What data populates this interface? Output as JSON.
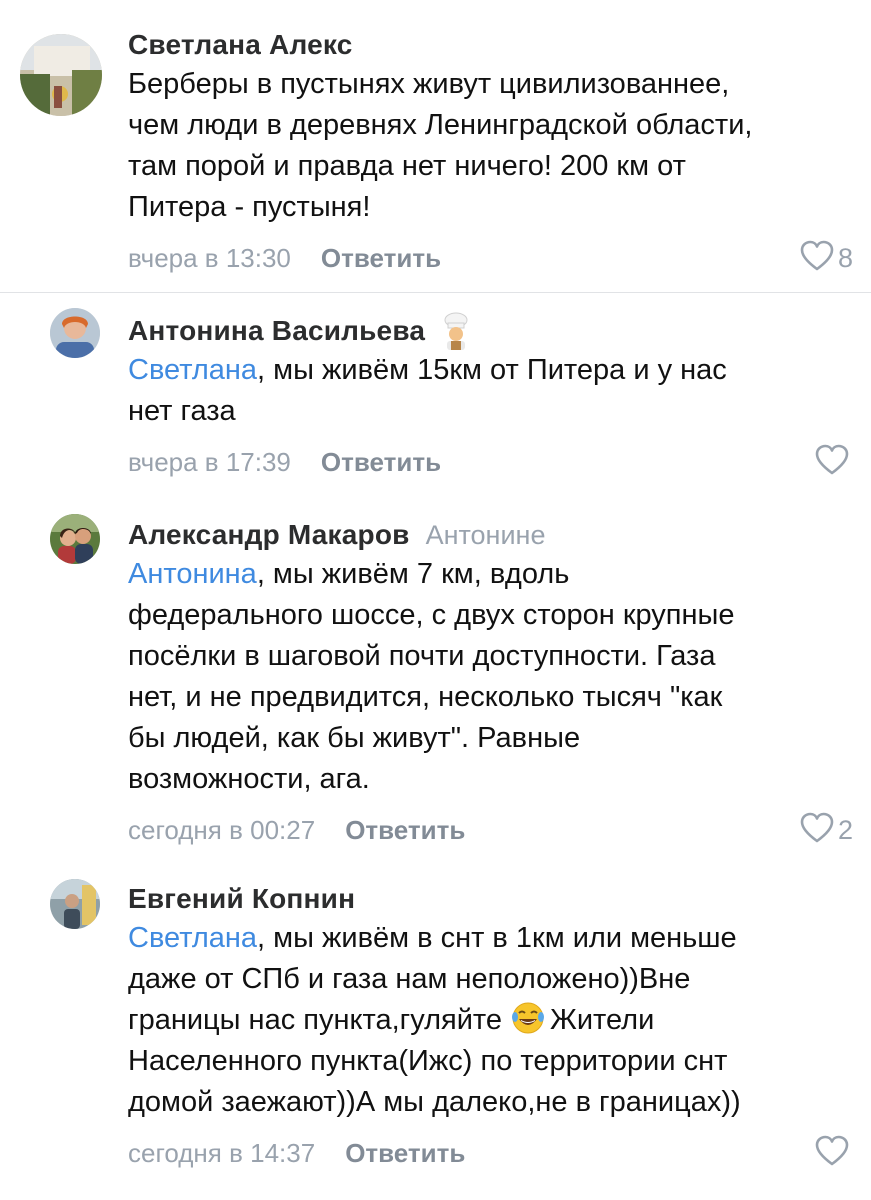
{
  "comments": [
    {
      "author": "Светлана Алекс",
      "reply_to": "",
      "mention": "",
      "text": "Берберы в пустынях живут цивилизованнее,\nчем люди в деревнях Ленинградской области,\nтам порой и правда нет ничего! 200 км от\nПитера - пустыня!",
      "time": "вчера в 13:30",
      "reply_label": "Ответить",
      "likes": "8",
      "avatar_icon": "person-photo"
    },
    {
      "author": "Антонина Васильева",
      "badge_icon": "cook-emoji",
      "reply_to": "",
      "mention": "Светлана",
      "text": ", мы живём 15км от Питера и у нас\nнет газа",
      "time": "вчера в 17:39",
      "reply_label": "Ответить",
      "likes": "",
      "avatar_icon": "person-photo"
    },
    {
      "author": "Александр Макаров",
      "reply_to": "Антонине",
      "mention": "Антонина",
      "text": ", мы живём 7 км, вдоль\nфедерального шоссе, с двух сторон крупные\nпосёлки в шаговой почти доступности. Газа\nнет, и не предвидится, несколько тысяч \"как\nбы людей, как бы живут\". Равные\nвозможности, ага.",
      "time": "сегодня в 00:27",
      "reply_label": "Ответить",
      "likes": "2",
      "avatar_icon": "couple-photo"
    },
    {
      "author": "Евгений Копнин",
      "reply_to": "",
      "mention": "Светлана",
      "text_before_emoji": ", мы живём в снт в 1км или меньше\nдаже от СПб и газа нам неположено))Вне\nграницы нас пункта,гуляйте ",
      "emoji_icon": "tears-of-joy-emoji",
      "text_after_emoji": "Жители\nНаселенного пункта(Ижс) по территории снт\nдомой заежают))А мы далеко,не в границах))",
      "time": "сегодня в 14:37",
      "reply_label": "Ответить",
      "likes": "",
      "avatar_icon": "person-photo"
    }
  ],
  "colors": {
    "mention": "#3f8ae0",
    "secondary": "#99a2ad",
    "divider": "#e1e3e6"
  }
}
